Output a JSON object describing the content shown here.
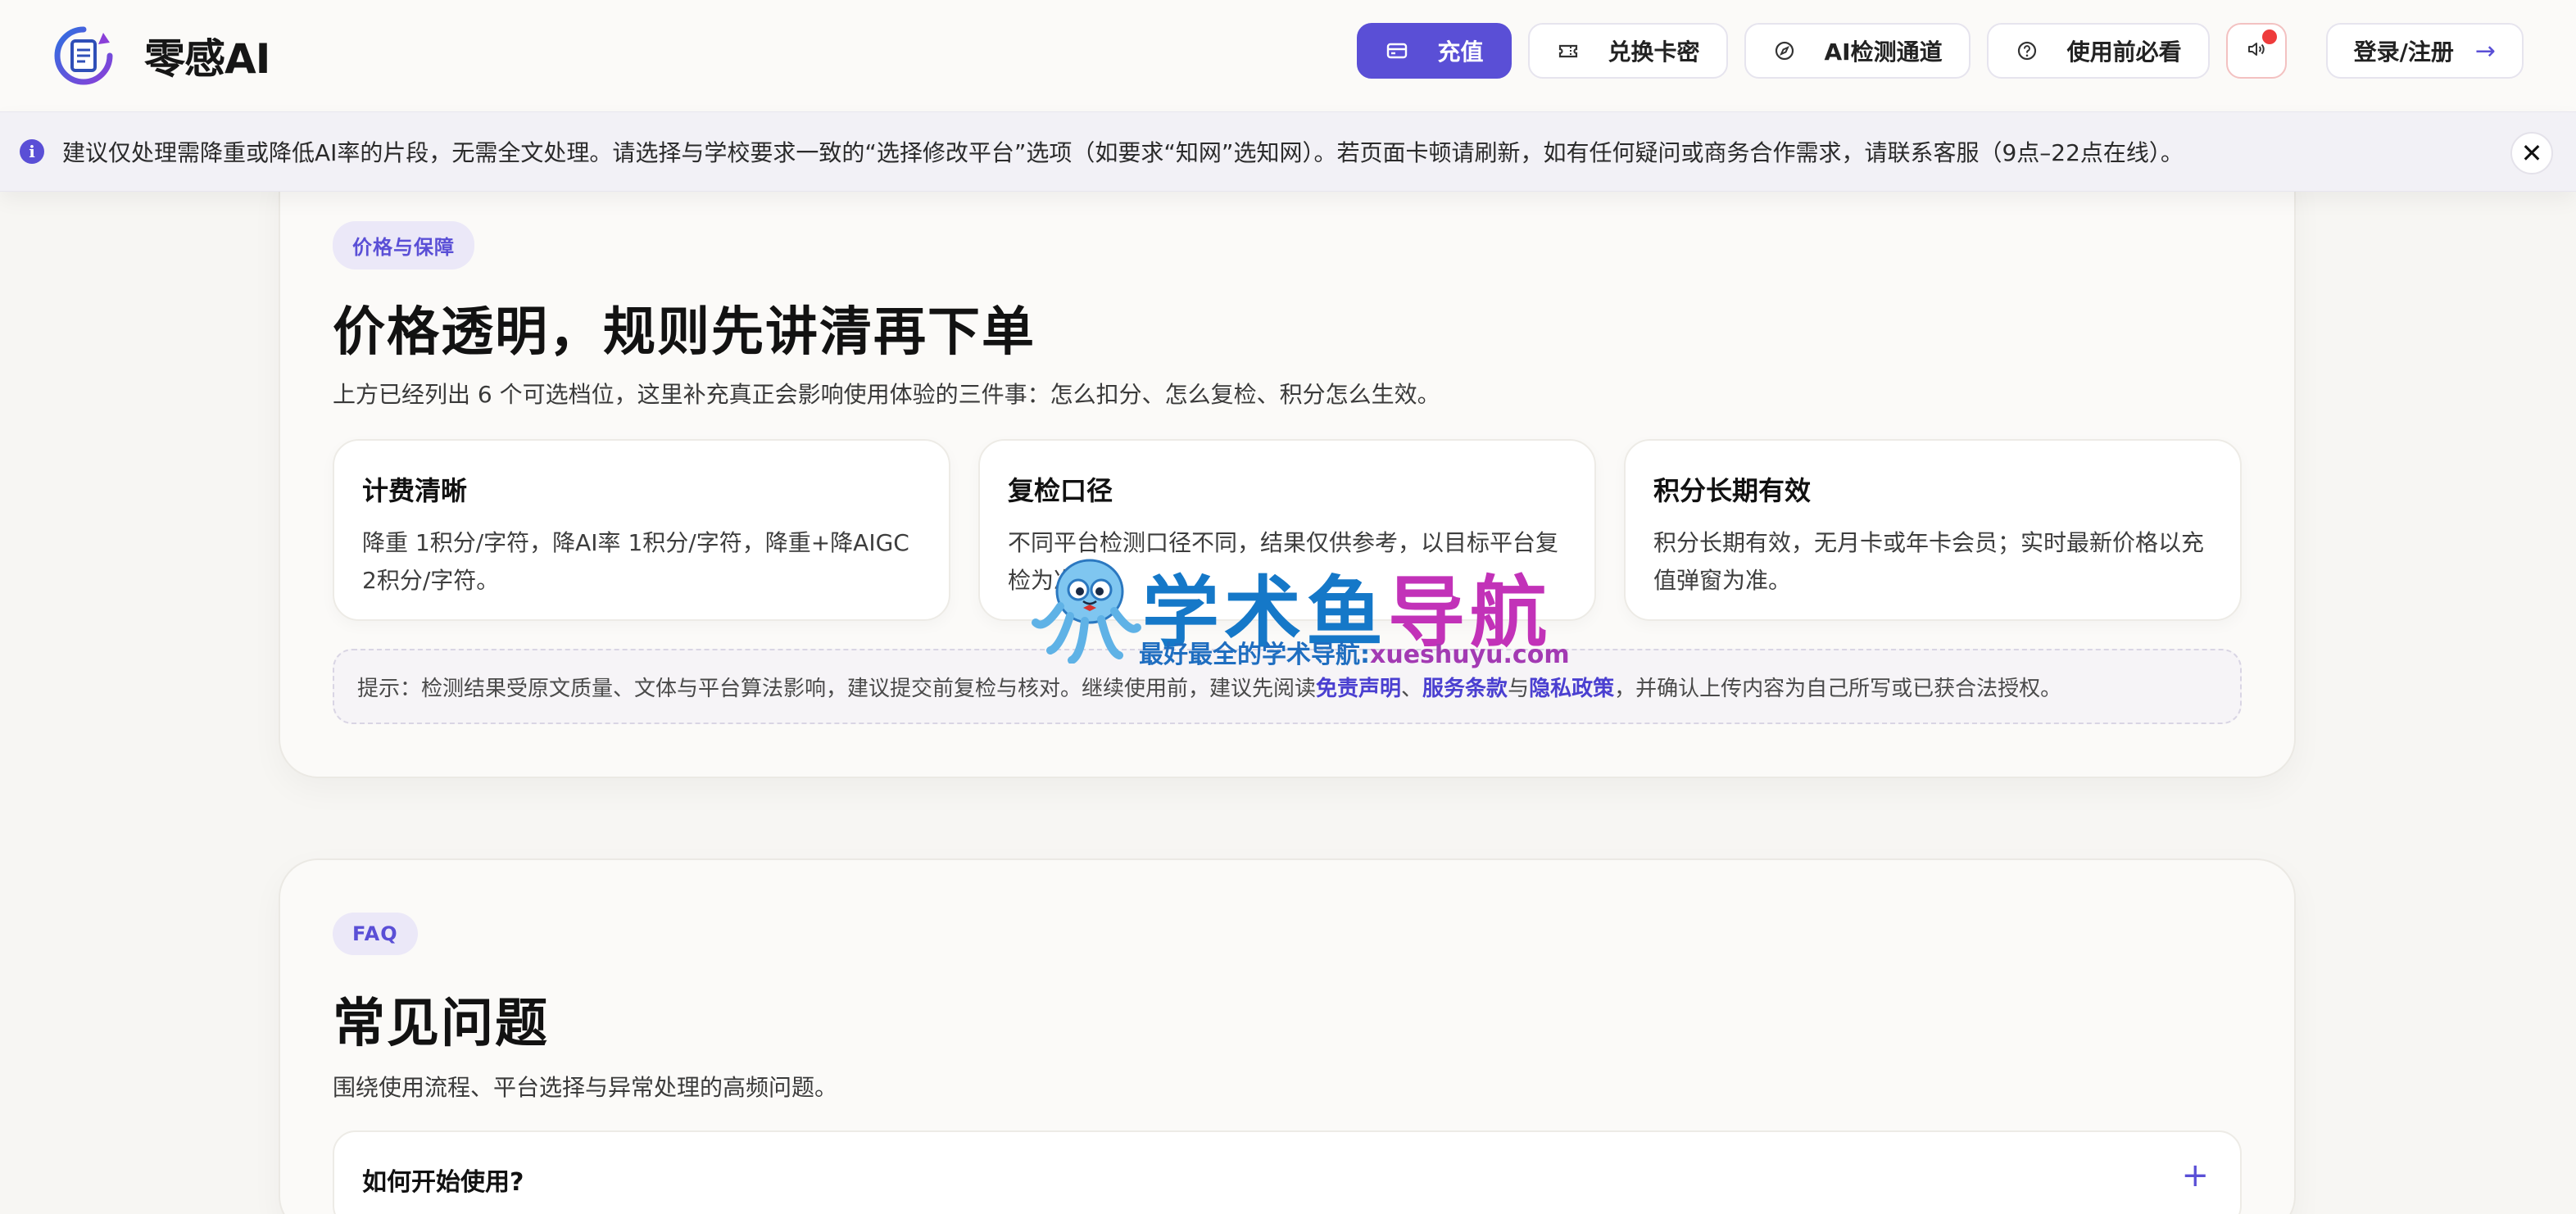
{
  "app": {
    "name": "零感AI"
  },
  "nav": {
    "recharge": "充值",
    "redeem": "兑换卡密",
    "ai_detect": "AI检测通道",
    "guide": "使用前必看",
    "login": "登录/注册"
  },
  "notice": {
    "text": "建议仅处理需降重或降低AI率的片段，无需全文处理。请选择与学校要求一致的“选择修改平台”选项（如要求“知网”选知网）。若页面卡顿请刷新，如有任何疑问或商务合作需求，请联系客服（9点–22点在线）。"
  },
  "pricing": {
    "tag": "价格与保障",
    "title": "价格透明，规则先讲清再下单",
    "subtitle": "上方已经列出 6 个可选档位，这里补充真正会影响使用体验的三件事：怎么扣分、怎么复检、积分怎么生效。",
    "cards": [
      {
        "title": "计费清晰",
        "body": "降重 1积分/字符，降AI率 1积分/字符，降重+降AIGC 2积分/字符。"
      },
      {
        "title": "复检口径",
        "body": "不同平台检测口径不同，结果仅供参考，以目标平台复检为准。"
      },
      {
        "title": "积分长期有效",
        "body": "积分长期有效，无月卡或年卡会员；实时最新价格以充值弹窗为准。"
      }
    ],
    "tip": {
      "prefix": "提示：检测结果受原文质量、文体与平台算法影响，建议提交前复检与核对。继续使用前，建议先阅读",
      "link1": "免责声明",
      "sep1": "、",
      "link2": "服务条款",
      "sep2": "与",
      "link3": "隐私政策",
      "suffix": "，并确认上传内容为自己所写或已获合法授权。"
    }
  },
  "faq": {
    "tag": "FAQ",
    "title": "常见问题",
    "subtitle": "围绕使用流程、平台选择与异常处理的高频问题。",
    "items": [
      {
        "question": "如何开始使用?",
        "toggle": "+"
      }
    ]
  },
  "watermark": {
    "title_part1": "学术鱼",
    "title_part2": "导航",
    "sub_text": "最好最全的学术导航:",
    "sub_url": "xueshuyu.com"
  },
  "colors": {
    "accent": "#5a4fd6",
    "alert_dot": "#ee3b3b"
  }
}
